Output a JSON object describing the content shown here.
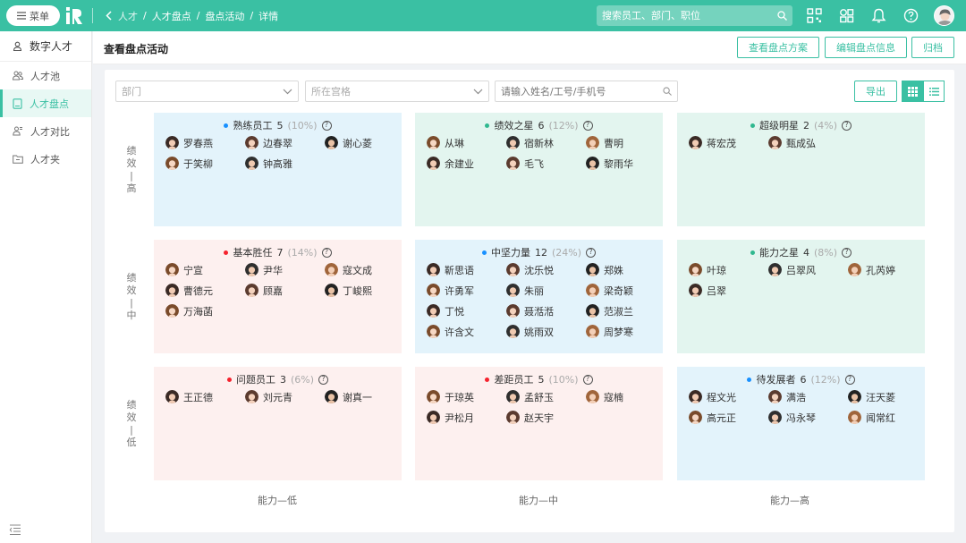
{
  "topbar": {
    "menu_label": "菜单",
    "breadcrumb": [
      "人才",
      "人才盘点",
      "盘点活动",
      "详情"
    ],
    "breadcrumb_sep": "/",
    "search_placeholder": "搜索员工、部门、职位",
    "icons": [
      "qrcode-icon",
      "apps-icon",
      "bell-icon",
      "help-icon"
    ],
    "accent": "#3ac0a3"
  },
  "sidebar": {
    "title": "数字人才",
    "items": [
      {
        "label": "人才池",
        "icon": "talent-pool-icon"
      },
      {
        "label": "人才盘点",
        "icon": "document-icon",
        "active": true
      },
      {
        "label": "人才对比",
        "icon": "compare-icon"
      },
      {
        "label": "人才夹",
        "icon": "folder-icon"
      }
    ]
  },
  "header": {
    "title": "查看盘点活动",
    "buttons": [
      "查看盘点方案",
      "编辑盘点信息",
      "归档"
    ]
  },
  "filters": {
    "department_placeholder": "部门",
    "grid_placeholder": "所在宫格",
    "search_placeholder": "请输入姓名/工号/手机号",
    "export_label": "导出"
  },
  "axes": {
    "rows": [
      "绩效｜高",
      "绩效｜中",
      "绩效｜低"
    ],
    "cols": [
      "能力—低",
      "能力—中",
      "能力—高"
    ]
  },
  "cells": [
    {
      "title": "熟练员工",
      "count": "5",
      "pct": "(10%)",
      "color": "blue",
      "dot": "#1890ff",
      "people": [
        "罗春燕",
        "边春翠",
        "谢心菱",
        "于笑柳",
        "钟高雅"
      ]
    },
    {
      "title": "绩效之星",
      "count": "6",
      "pct": "(12%)",
      "color": "green",
      "dot": "#2fb88f",
      "people": [
        "从琳",
        "宿新林",
        "曹明",
        "余建业",
        "毛飞",
        "黎雨华"
      ]
    },
    {
      "title": "超级明星",
      "count": "2",
      "pct": "(4%)",
      "color": "green",
      "dot": "#2fb88f",
      "people": [
        "蒋宏茂",
        "甄成弘"
      ]
    },
    {
      "title": "基本胜任",
      "count": "7",
      "pct": "(14%)",
      "color": "pink",
      "dot": "#f5222d",
      "people": [
        "宁宣",
        "尹华",
        "寇文成",
        "曹德元",
        "顾嘉",
        "丁峻熙",
        "万海菡"
      ]
    },
    {
      "title": "中坚力量",
      "count": "12",
      "pct": "(24%)",
      "color": "blue",
      "dot": "#1890ff",
      "people": [
        "靳思语",
        "沈乐悦",
        "郑姝",
        "许勇军",
        "朱丽",
        "梁奇颖",
        "丁悦",
        "聂湉湉",
        "范淑兰",
        "许含文",
        "姚雨双",
        "周梦寒"
      ]
    },
    {
      "title": "能力之星",
      "count": "4",
      "pct": "(8%)",
      "color": "green",
      "dot": "#2fb88f",
      "people": [
        "叶琼",
        "吕翠风",
        "孔芮婷",
        "吕翠"
      ]
    },
    {
      "title": "问题员工",
      "count": "3",
      "pct": "(6%)",
      "color": "pink",
      "dot": "#f5222d",
      "people": [
        "王正德",
        "刘元青",
        "谢真一"
      ]
    },
    {
      "title": "差距员工",
      "count": "5",
      "pct": "(10%)",
      "color": "pink",
      "dot": "#f5222d",
      "people": [
        "于琼英",
        "孟舒玉",
        "寇楠",
        "尹松月",
        "赵天宇"
      ]
    },
    {
      "title": "待发展者",
      "count": "6",
      "pct": "(12%)",
      "color": "blue",
      "dot": "#1890ff",
      "people": [
        "程文光",
        "满浩",
        "汪天菱",
        "高元正",
        "冯永琴",
        "闻常红"
      ]
    }
  ]
}
